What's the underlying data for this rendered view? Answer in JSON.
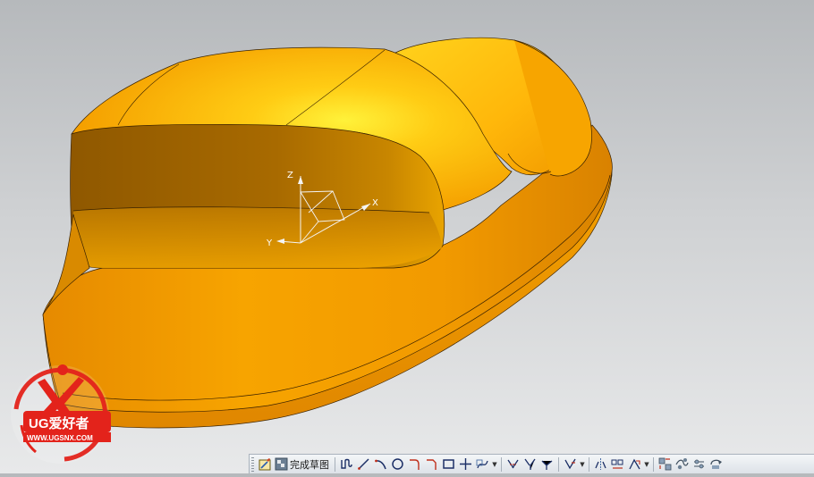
{
  "viewport": {
    "background_top": "#b6b9bc",
    "background_bottom": "#e8e9ea",
    "model_color": "#f5a300",
    "model_highlight": "#ffe93a",
    "model_shadow": "#9a5f00",
    "csys_labels": {
      "z": "Z",
      "x": "X",
      "y": "Y"
    }
  },
  "watermark": {
    "logo_text": "UG爱好者",
    "url": "WWW.UGSNX.COM",
    "color": "#e3231b"
  },
  "sketch_toolbar": {
    "finish_sketch_label": "完成草图",
    "items": [
      "sketch-icon",
      "finish-flag-icon",
      "profile-icon",
      "line-icon",
      "arc-icon",
      "circle-icon",
      "fillet-icon",
      "chamfer-icon",
      "rectangle-icon",
      "point-icon",
      "studio-spline-icon",
      "offset-curve-icon",
      "trim-icon",
      "extend-icon",
      "corner-icon",
      "make-corner-icon",
      "mirror-icon",
      "pattern-icon",
      "constraint-icon",
      "display-constraint-icon",
      "auto-dimension-icon",
      "sketch-settings-icon",
      "reattach-icon",
      "update-model-icon"
    ]
  }
}
